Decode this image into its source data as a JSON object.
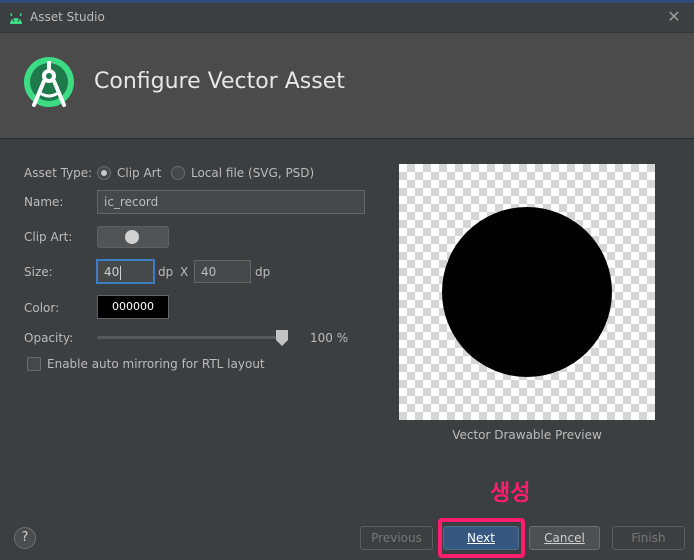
{
  "window": {
    "title": "Asset Studio",
    "close_glyph": "✕"
  },
  "header": {
    "title": "Configure Vector Asset"
  },
  "form": {
    "asset_type_label": "Asset Type:",
    "asset_type_options": [
      "Clip Art",
      "Local file (SVG, PSD)"
    ],
    "asset_type_selected": "Clip Art",
    "name_label": "Name:",
    "name_value": "ic_record",
    "clip_art_label": "Clip Art:",
    "size_label": "Size:",
    "width_value": "40",
    "height_value": "40",
    "unit": "dp",
    "times": "X",
    "color_label": "Color:",
    "color_value": "000000",
    "opacity_label": "Opacity:",
    "opacity_value": "100 %",
    "opacity_fraction": 1.0,
    "rtl_label": "Enable auto mirroring for RTL layout",
    "rtl_checked": false
  },
  "preview": {
    "caption": "Vector Drawable Preview"
  },
  "annotation": {
    "text": "생성",
    "color": "#ff1f6e"
  },
  "footer": {
    "help_glyph": "?",
    "previous_label": "Previous",
    "next_label": "Next",
    "cancel_label": "Cancel",
    "finish_label": "Finish"
  },
  "colors": {
    "accent": "#3d7dc4",
    "primary_button": "#365880",
    "background": "#3c3f41"
  }
}
